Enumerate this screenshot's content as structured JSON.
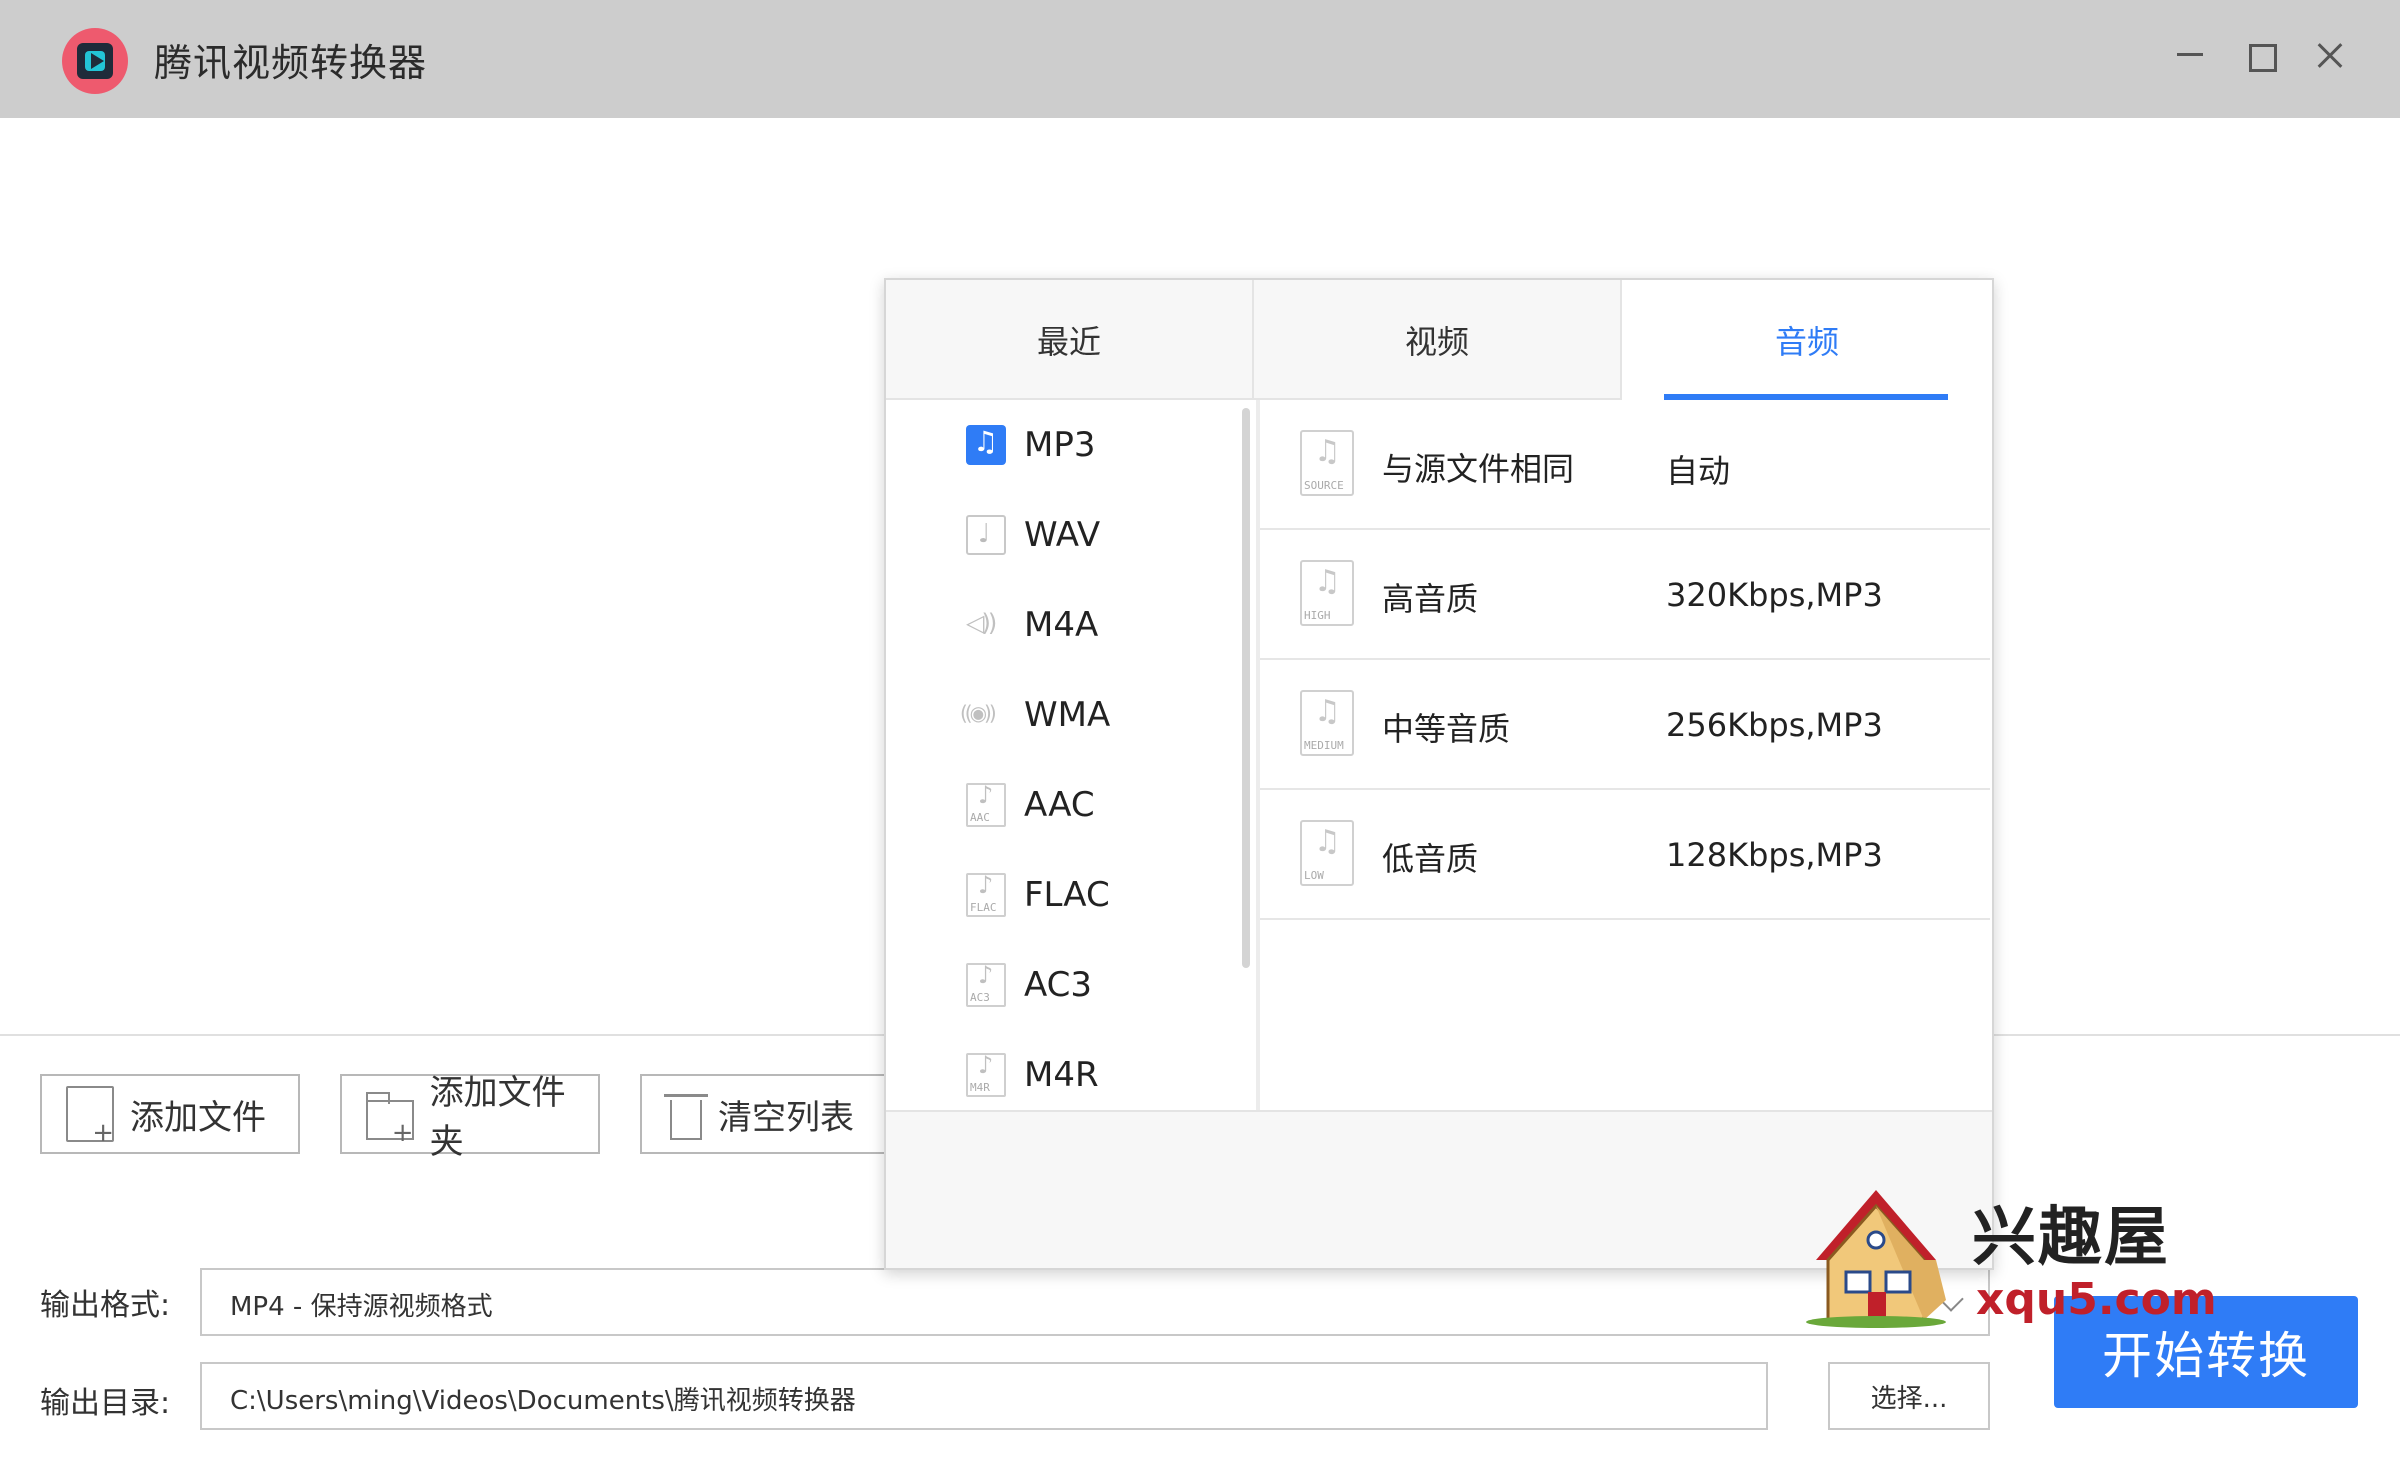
{
  "window": {
    "title": "腾讯视频转换器",
    "icons": {
      "logo": "tencent-video-converter-logo",
      "minimize": "minimize-icon",
      "maximize": "maximize-icon",
      "close": "close-icon"
    }
  },
  "toolbar": {
    "add_file_label": "添加文件",
    "add_folder_label": "添加文件夹",
    "clear_list_label": "清空列表"
  },
  "output": {
    "format_label": "输出格式:",
    "format_value": "MP4 - 保持源视频格式",
    "dir_label": "输出目录:",
    "dir_value": "C:\\Users\\ming\\Videos\\Documents\\腾讯视频转换器",
    "choose_label": "选择...",
    "start_label": "开始转换"
  },
  "format_popup": {
    "tabs": [
      {
        "label": "最近",
        "active": false
      },
      {
        "label": "视频",
        "active": false
      },
      {
        "label": "音频",
        "active": true
      }
    ],
    "formats": [
      {
        "label": "MP3",
        "icon": "music-note-icon",
        "selected": true
      },
      {
        "label": "WAV",
        "icon": "wav-file-icon",
        "selected": false
      },
      {
        "label": "M4A",
        "icon": "speaker-icon",
        "selected": false
      },
      {
        "label": "WMA",
        "icon": "wma-icon",
        "selected": false
      },
      {
        "label": "AAC",
        "icon": "aac-file-icon",
        "tag": "AAC",
        "selected": false
      },
      {
        "label": "FLAC",
        "icon": "flac-file-icon",
        "tag": "FLAC",
        "selected": false
      },
      {
        "label": "AC3",
        "icon": "ac3-file-icon",
        "tag": "AC3",
        "selected": false
      },
      {
        "label": "M4R",
        "icon": "m4r-file-icon",
        "tag": "M4R",
        "selected": false
      }
    ],
    "qualities": [
      {
        "name": "与源文件相同",
        "value": "自动",
        "tag": "SOURCE"
      },
      {
        "name": "高音质",
        "value": "320Kbps,MP3",
        "tag": "HIGH"
      },
      {
        "name": "中等音质",
        "value": "256Kbps,MP3",
        "tag": "MEDIUM"
      },
      {
        "name": "低音质",
        "value": "128Kbps,MP3",
        "tag": "LOW"
      }
    ]
  },
  "watermark": {
    "text": "兴趣屋",
    "url": "xqu5.com"
  },
  "colors": {
    "accent": "#2f7cf6",
    "titlebar": "#cdcdcd",
    "logo": "#ee5a6e"
  }
}
